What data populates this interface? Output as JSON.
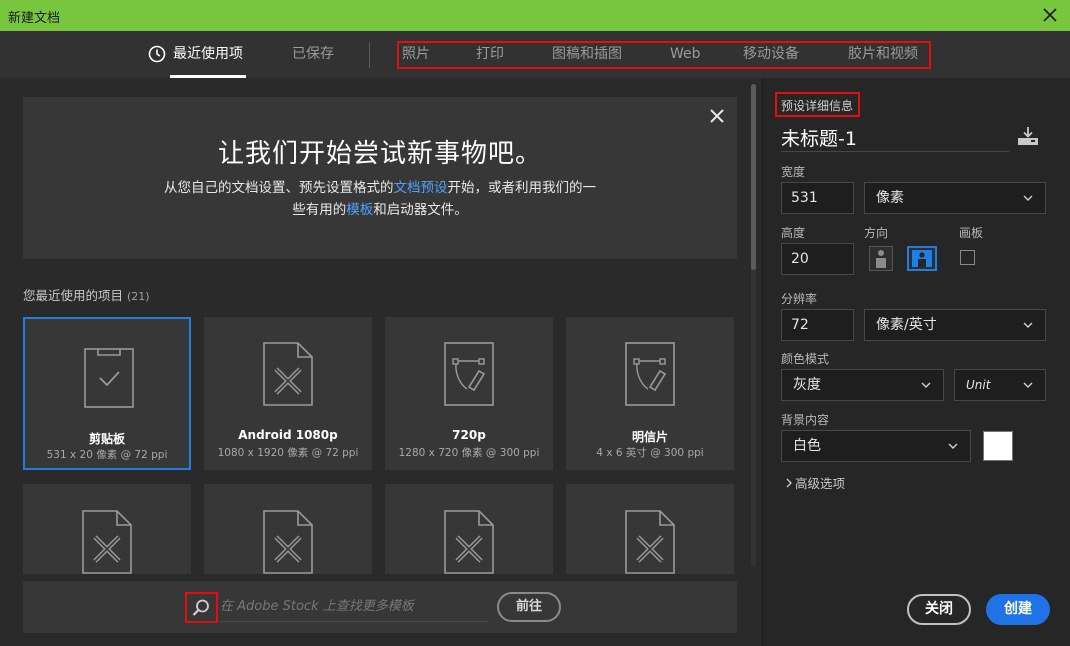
{
  "window": {
    "title": "新建文档"
  },
  "tabs": {
    "recent": "最近使用项",
    "saved": "已保存",
    "categories": [
      "照片",
      "打印",
      "图稿和插图",
      "Web",
      "移动设备",
      "胶片和视频"
    ]
  },
  "welcome": {
    "heading": "让我们开始尝试新事物吧。",
    "line1_a": "从您自己的文档设置、预先设置格式的",
    "line1_link": "文档预设",
    "line1_b": "开始，或者利用我们的一",
    "line2_a": "些有用的",
    "line2_link": "模板",
    "line2_b": "和启动器文件。"
  },
  "recent": {
    "label": "您最近使用的项目",
    "count": "(21)",
    "items": [
      {
        "name": "剪贴板",
        "meta": "531 x 20 像素 @ 72 ppi",
        "selected": true,
        "icon": "clipboard-icon"
      },
      {
        "name": "Android 1080p",
        "meta": "1080 x 1920 像素 @ 72 ppi",
        "icon": "document-ruler-pencil-icon"
      },
      {
        "name": "720p",
        "meta": "1280 x 720 像素 @ 300 ppi",
        "icon": "document-pen-path-icon"
      },
      {
        "name": "明信片",
        "meta": "4 x 6 英寸 @ 300 ppi",
        "icon": "document-pen-path-icon"
      }
    ]
  },
  "stock": {
    "placeholder": "在 Adobe Stock 上查找更多模板",
    "go": "前往"
  },
  "preset": {
    "section_title": "预设详细信息",
    "doc_name": "未标题-1",
    "width_label": "宽度",
    "width_value": "531",
    "width_unit": "像素",
    "height_label": "高度",
    "height_value": "20",
    "orientation_label": "方向",
    "artboard_label": "画板",
    "resolution_label": "分辨率",
    "resolution_value": "72",
    "resolution_unit": "像素/英寸",
    "color_mode_label": "颜色模式",
    "color_mode": "灰度",
    "bit_depth": "Unit",
    "background_label": "背景内容",
    "background": "白色",
    "background_color": "#ffffff",
    "advanced": "高级选项"
  },
  "actions": {
    "close": "关闭",
    "create": "创建"
  },
  "colors": {
    "title_bar": "#78c63e",
    "accent": "#1f73e6",
    "highlight": "#e01010"
  }
}
